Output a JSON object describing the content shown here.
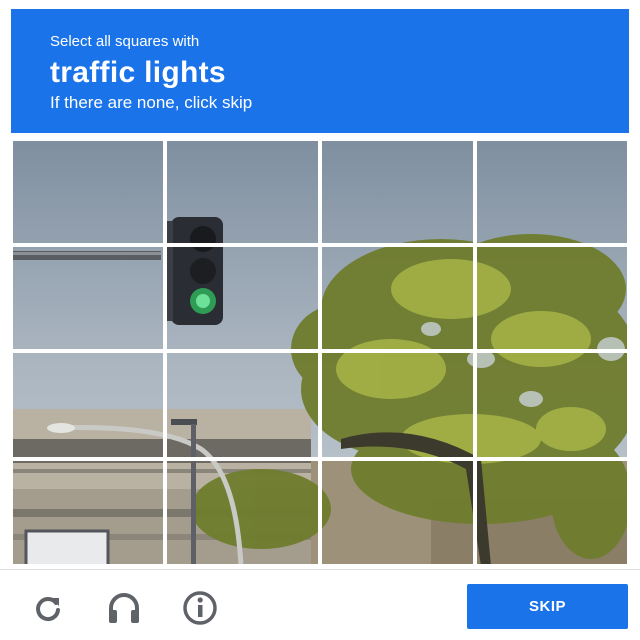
{
  "header": {
    "instruction": "Select all squares with",
    "keyword": "traffic lights",
    "subtext": "If there are none, click skip"
  },
  "grid": {
    "rows": 4,
    "columns": 4
  },
  "footer": {
    "icons": [
      "reload-icon",
      "audio-headphones-icon",
      "info-icon"
    ],
    "skip_label": "SKIP"
  },
  "colors": {
    "accent": "#1a73e8",
    "grid_lines": "#ffffff"
  }
}
